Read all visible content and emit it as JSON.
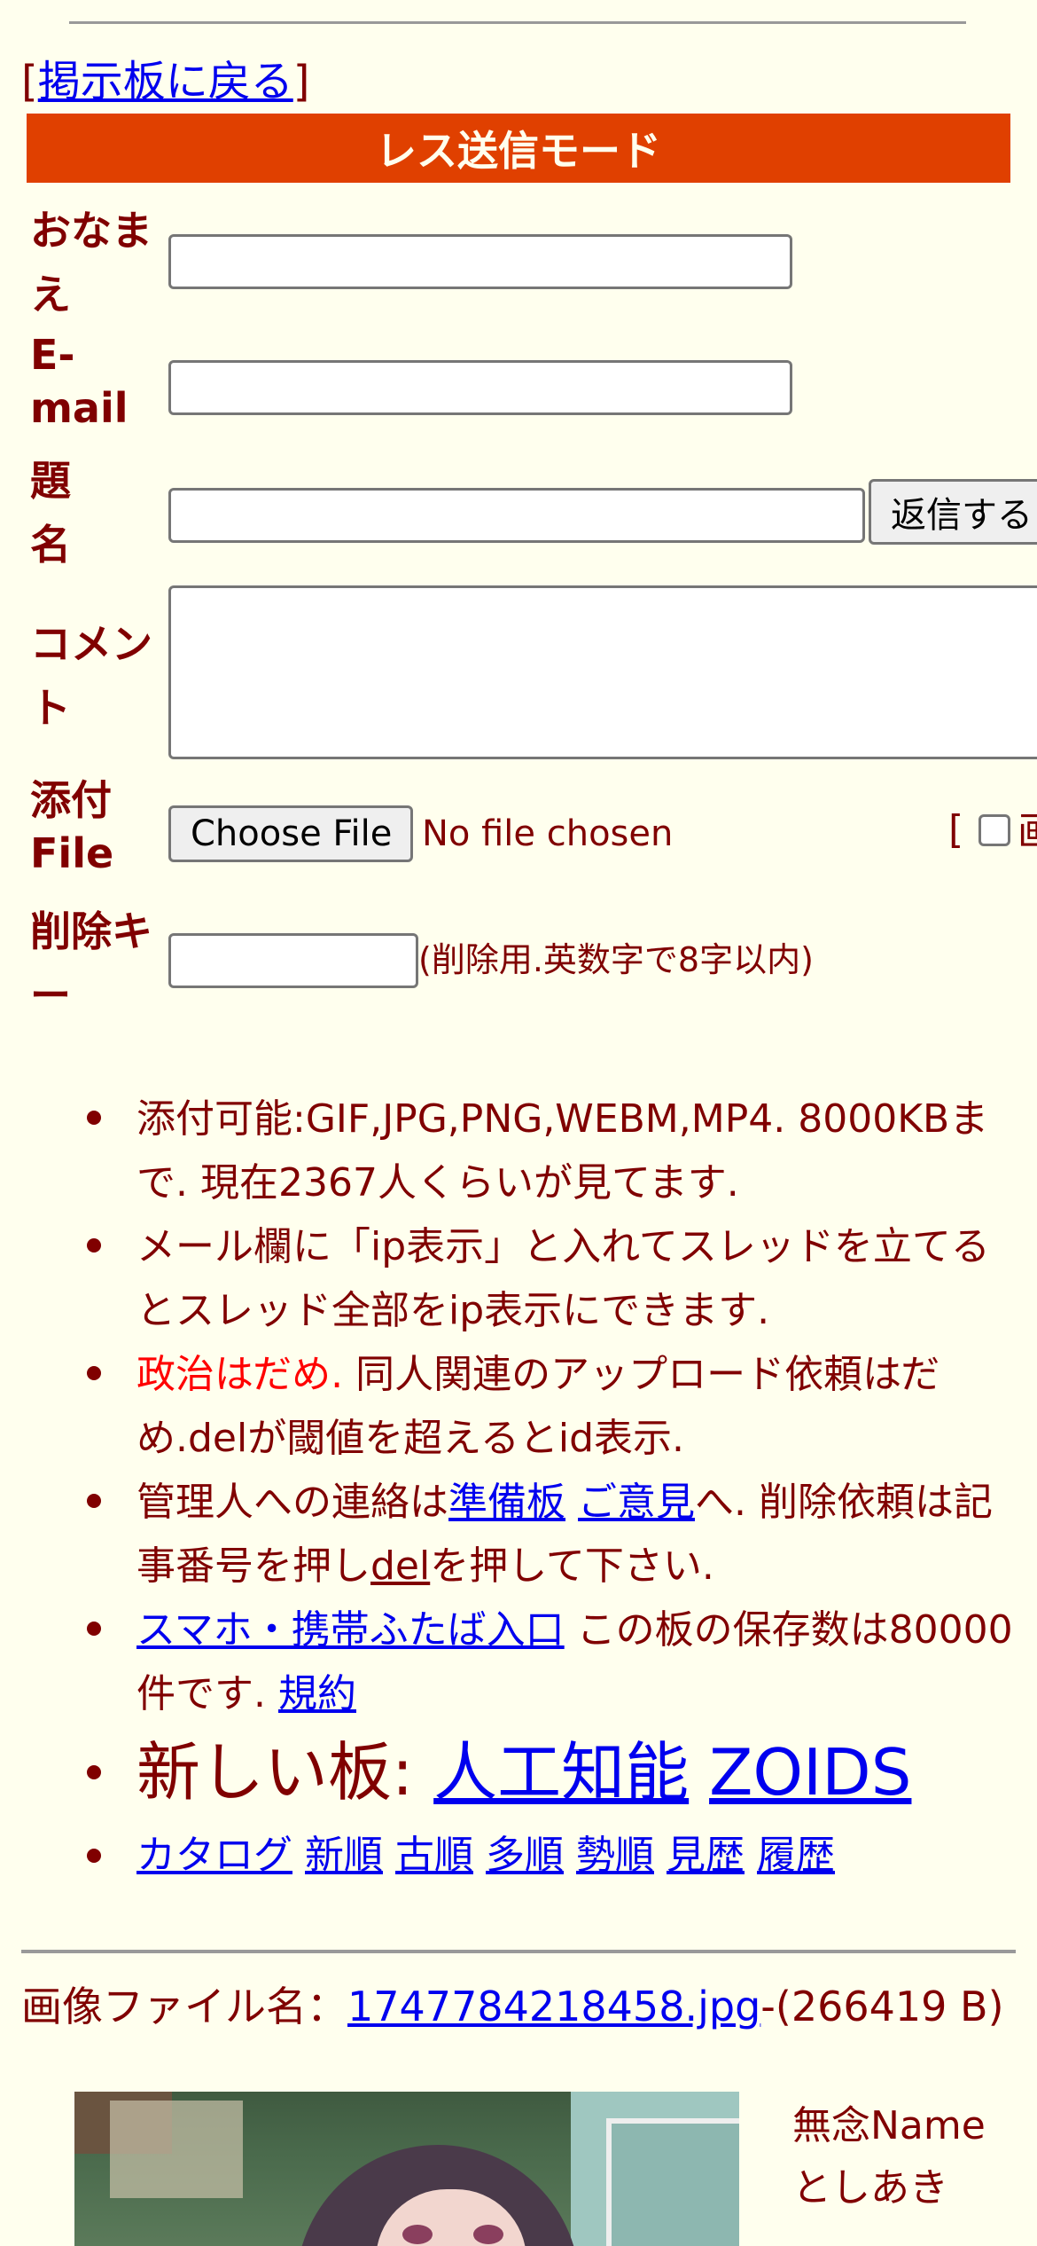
{
  "back_link": {
    "bracket_open": "[",
    "label": "掲示板に戻る",
    "bracket_close": "]"
  },
  "mode_title": "レス送信モード",
  "form": {
    "name_label_line1": "おなま",
    "name_label_line2": "え",
    "email_label_line1": "E-",
    "email_label_line2": "mail",
    "subject_label_line1": "題",
    "subject_label_line2": "名",
    "submit_label": "返信する",
    "comment_label_line1": "コメン",
    "comment_label_line2": "ト",
    "file_label_line1": "添付",
    "file_label_line2": "File",
    "choose_file_label": "Choose File",
    "no_file_text": "No file chosen",
    "bracket_text": "[",
    "checkbox_label": "画",
    "delkey_label_line1": "削除キ",
    "delkey_label_line2": "ー",
    "delkey_note": "(削除用.英数字で8字以内)"
  },
  "rules": {
    "r1": "添付可能:GIF,JPG,PNG,WEBM,MP4. 8000KBまで. 現在2367人くらいが見てます.",
    "r2": "メール欄に「ip表示」と入れてスレッドを立てるとスレッド全部をip表示にできます.",
    "r3_red": "政治はだめ.",
    "r3_rest": " 同人関連のアップロード依頼はだめ.delが閾値を超えるとid表示.",
    "r4_pre": "管理人への連絡は",
    "r4_link1": "準備板",
    "r4_space": " ",
    "r4_link2": "ご意見",
    "r4_mid": "へ. 削除依頼は記事番号を押し",
    "r4_link3": "del",
    "r4_post": "を押して下さい.",
    "r5_link": "スマホ・携帯ふたば入口",
    "r5_mid": " この板の保存数は80000件です. ",
    "r5_link2": "規約",
    "r6_pre": "新しい板: ",
    "r6_link1": "人工知能",
    "r6_link2": "ZOIDS",
    "nav": [
      "カタログ",
      "新順",
      "古順",
      "多順",
      "勢順",
      "見歴",
      "履歴"
    ]
  },
  "post": {
    "file_prefix": "画像ファイル名：",
    "file_name": "1747784218458.jpg",
    "file_size": "-(266419 B)",
    "name_line1": "無念Name",
    "name_line2": "としあき"
  },
  "colors": {
    "background": "#ffffee",
    "text": "#800000",
    "mode_bar": "#e04000",
    "link": "#0000ee",
    "warning": "#ff0000"
  }
}
